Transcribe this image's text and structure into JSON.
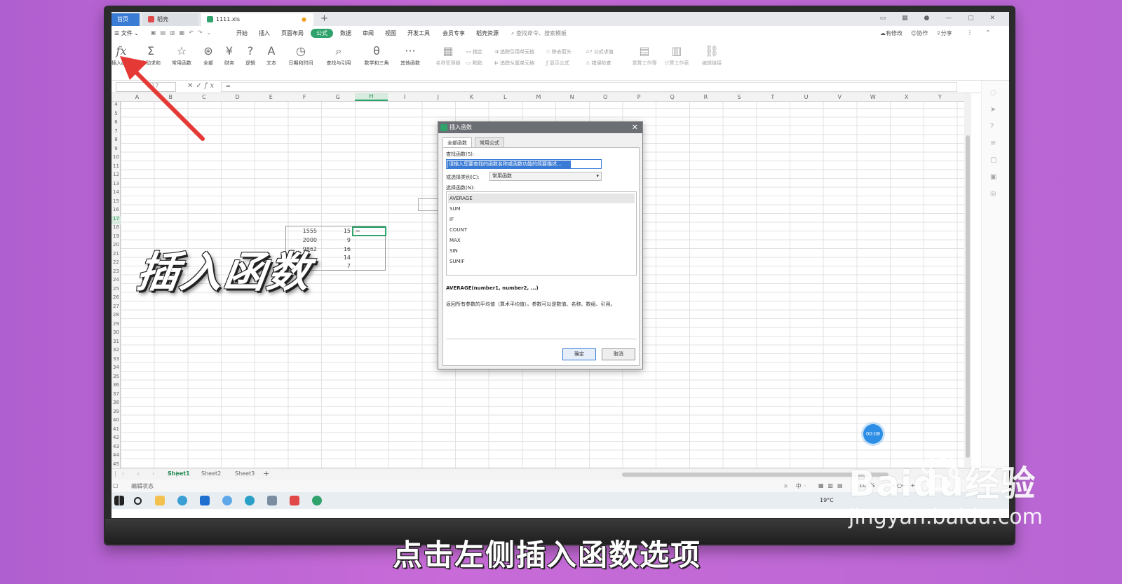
{
  "tabs": {
    "home": "首页",
    "doc2": "稻壳",
    "doc3": "1111.xls"
  },
  "menu": {
    "file": "文件",
    "items": [
      "开始",
      "插入",
      "页面布局",
      "公式",
      "数据",
      "审阅",
      "视图",
      "开发工具",
      "会员专享",
      "稻壳资源"
    ],
    "active": "公式",
    "search": "查找命令、搜索模板",
    "right": [
      "有修改",
      "协作",
      "分享"
    ]
  },
  "ribbon": {
    "buttons": [
      {
        "icon": "fx",
        "label": "插入函数"
      },
      {
        "icon": "Σ",
        "label": "自动求和"
      },
      {
        "icon": "☆",
        "label": "常用函数"
      },
      {
        "icon": "⊛",
        "label": "全部"
      },
      {
        "icon": "¥",
        "label": "财务"
      },
      {
        "icon": "?",
        "label": "逻辑"
      },
      {
        "icon": "A",
        "label": "文本"
      },
      {
        "icon": "◷",
        "label": "日期和时间"
      },
      {
        "icon": "⌕",
        "label": "查找与引用"
      },
      {
        "icon": "θ",
        "label": "数学和三角"
      },
      {
        "icon": "···",
        "label": "其他函数"
      }
    ],
    "dim": [
      {
        "label": "名称管理器"
      },
      {
        "label": "重算工作簿"
      },
      {
        "label": "计算工作表"
      },
      {
        "label": "编辑链接"
      }
    ],
    "small": [
      "指定",
      "粘贴",
      "追踪引用单元格",
      "追踪从属单元格",
      "移去箭头",
      "显示公式",
      "公式求值",
      "错误检查"
    ]
  },
  "formula": {
    "namebox": "H17",
    "content": "="
  },
  "columns": [
    "A",
    "B",
    "C",
    "D",
    "E",
    "F",
    "G",
    "H",
    "I",
    "J",
    "K",
    "L",
    "M",
    "N",
    "O",
    "P",
    "Q",
    "R",
    "S",
    "T",
    "U",
    "V",
    "W",
    "X",
    "Y"
  ],
  "selected_col": "H",
  "rows": [
    "4",
    "5",
    "6",
    "7",
    "8",
    "9",
    "10",
    "11",
    "12",
    "13",
    "14",
    "15",
    "16",
    "17",
    "18",
    "19",
    "20",
    "21",
    "22",
    "23",
    "24",
    "25",
    "26",
    "27",
    "28",
    "29",
    "30",
    "31",
    "32",
    "33",
    "34",
    "35",
    "36",
    "37",
    "38",
    "39",
    "40",
    "41",
    "42",
    "43",
    "44",
    "45"
  ],
  "selected_row": "17",
  "cells": {
    "f": [
      "1555",
      "2000",
      "9862",
      "",
      ""
    ],
    "g": [
      "15",
      "9",
      "16",
      "14",
      "7"
    ],
    "active": "="
  },
  "sheets": [
    "Sheet1",
    "Sheet2",
    "Sheet3"
  ],
  "status": {
    "mode": "编辑状态",
    "zoom": "100%"
  },
  "taskbar": {
    "temp": "19°C"
  },
  "dialog": {
    "title": "插入函数",
    "tabs": [
      "全部函数",
      "常用公式"
    ],
    "search_label": "查找函数(S):",
    "search_value": "请输入您要查找的函数名称或函数功能的简要描述...",
    "category_label": "或选择类别(C):",
    "category_value": "常用函数",
    "list_label": "选择函数(N):",
    "functions": [
      "AVERAGE",
      "SUM",
      "IF",
      "COUNT",
      "MAX",
      "SIN",
      "SUMIF"
    ],
    "selected": "AVERAGE",
    "signature": "AVERAGE(number1, number2, ...)",
    "description": "返回所有参数的平均值（算术平均值）。参数可以是数值、名称、数组、引用。",
    "ok": "确定",
    "cancel": "取消"
  },
  "timer": "00:08",
  "overlay": {
    "title": "插入函数",
    "subtitle": "点击左侧插入函数选项"
  },
  "watermark": {
    "brand": "Baidu经验",
    "url": "jingyan.baidu.com"
  },
  "colors": {
    "accent": "#2fa36b",
    "blue": "#3a7bd5",
    "arrow": "#e53935"
  }
}
